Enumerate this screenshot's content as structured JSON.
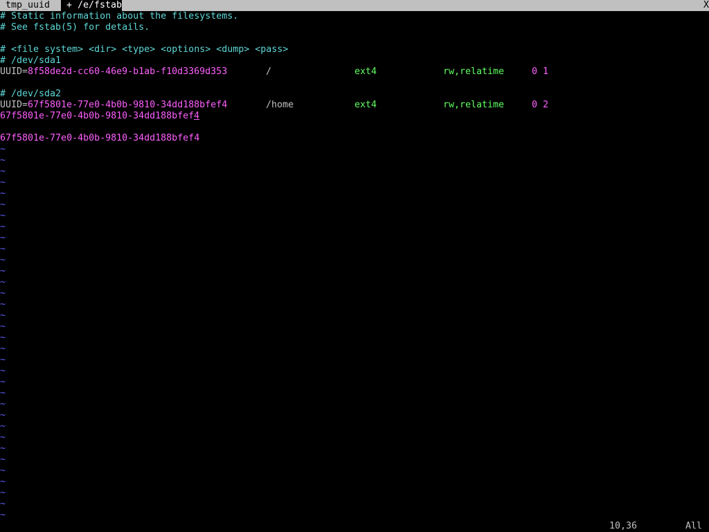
{
  "tabline": {
    "tabs": [
      {
        "label": " tmp_uuid ",
        "active": false
      },
      {
        "label": " + /e/fstab ",
        "active": true
      }
    ],
    "close_label": "X"
  },
  "buffer": {
    "comment1": "# Static information about the filesystems.",
    "comment2": "# See fstab(5) for details.",
    "comment3": "# <file system> <dir> <type> <options> <dump> <pass>",
    "comment4": "# /dev/sda1",
    "row1": {
      "key": "UUID=",
      "uuid": "8f58de2d-cc60-46e9-b1ab-f10d3369d353",
      "dir": "/",
      "type": "ext4",
      "options": "rw,relatime",
      "dumppass": "0 1"
    },
    "comment5": "# /dev/sda2",
    "row2": {
      "key": "UUID=",
      "uuid": "67f5801e-77e0-4b0b-9810-34dd188bfef4",
      "dir": "/home",
      "type": "ext4",
      "options": "rw,relatime",
      "dumppass": "0 2"
    },
    "line10_main": "67f5801e-77e0-4b0b-9810-34dd188bfef",
    "line10_cursor": "4",
    "line12": "67f5801e-77e0-4b0b-9810-34dd188bfef4",
    "tilde": "~"
  },
  "status": {
    "position": "10,36",
    "percent": "All"
  },
  "colors": {
    "comment": "#5fd7d7",
    "uuid": "#ff5fff",
    "type": "#5fff5f",
    "tilde": "#5f5fff"
  }
}
